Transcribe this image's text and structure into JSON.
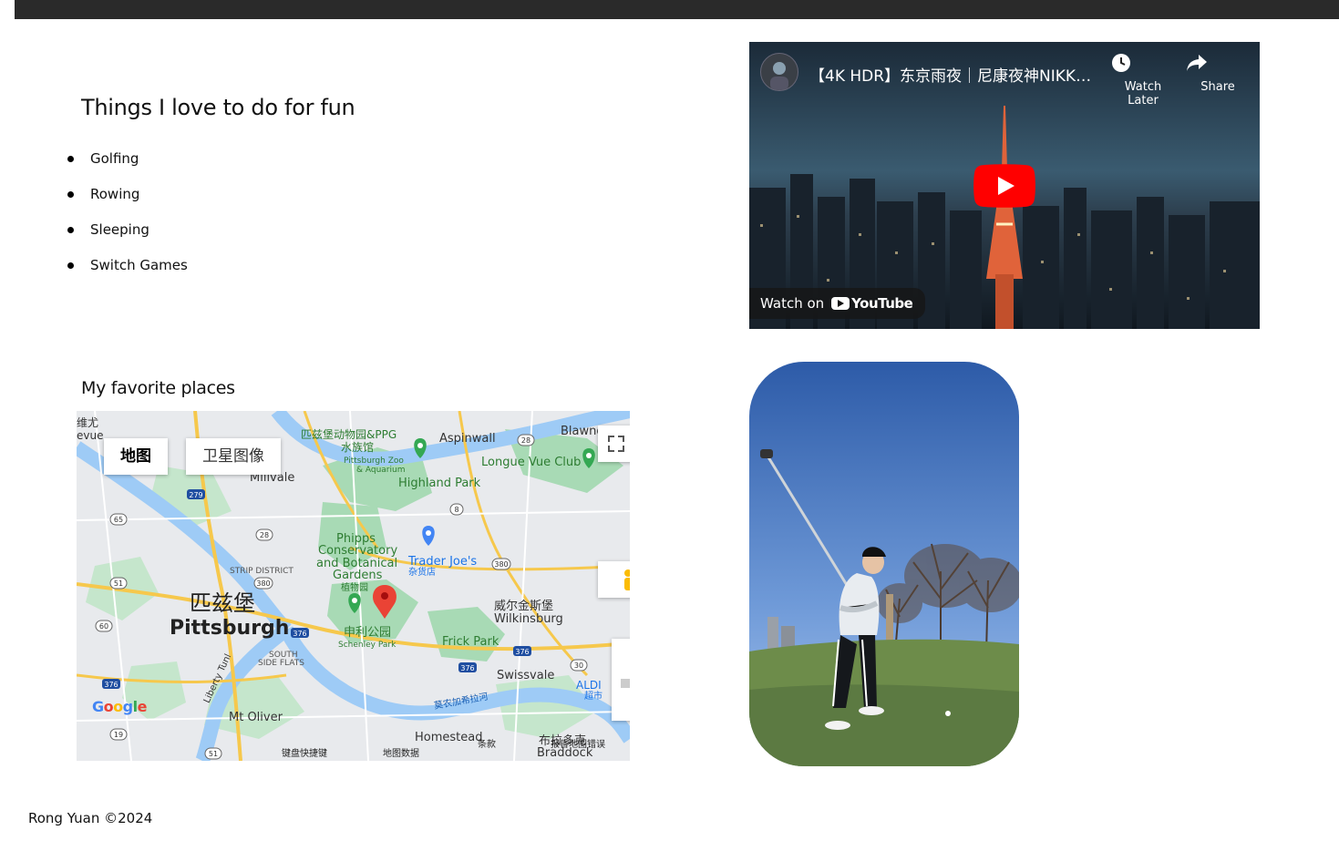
{
  "sections": {
    "fun_title": "Things I love to do for fun",
    "fun_items": [
      "Golfing",
      "Rowing",
      "Sleeping",
      "Switch Games"
    ],
    "places_title": "My favorite places"
  },
  "map": {
    "type_controls": [
      "地图",
      "卫星图像"
    ],
    "active_type": "地图",
    "labels": {
      "zoo": "匹兹堡动物园&PPG",
      "aquarium": "水族馆",
      "zoo_en1": "Pittsburgh Zoo",
      "zoo_en2": "& Aquarium",
      "aspinwall": "Aspinwall",
      "blawnox": "Blawno",
      "longue_vue": "Longue Vue Club",
      "highland_park": "Highland Park",
      "millvale": "Millvale",
      "phipps1": "Phipps",
      "phipps2": "Conservatory",
      "phipps3": "and Botanical",
      "phipps4": "Gardens",
      "phipps_cn": "植物园",
      "trader_joes": "Trader Joe's",
      "trader_joes_cn": "杂货店",
      "strip_district": "STRIP DISTRICT",
      "pittsburgh_cn": "匹兹堡",
      "pittsburgh": "Pittsburgh",
      "wilkinsburg_cn": "威尔金斯堡",
      "wilkinsburg": "Wilkinsburg",
      "schenley_cn": "申利公园",
      "schenley": "Schenley Park",
      "frick_park": "Frick Park",
      "south_side1": "SOUTH",
      "south_side2": "SIDE FLATS",
      "swissvale": "Swissvale",
      "aldi": "ALDI",
      "aldi_cn": "超市",
      "liberty_tunnel": "Liberty Tunl",
      "mt_oliver": "Mt Oliver",
      "homestead": "Homestead",
      "river": "莫农加希拉河",
      "braddock_cn": "布拉多克",
      "braddock": "Braddock",
      "weiyou": "维尤",
      "vue": "evue",
      "route_279": "279",
      "route_28a": "28",
      "route_28b": "28",
      "route_8": "8",
      "route_65": "65",
      "route_380a": "380",
      "route_380b": "380",
      "route_51a": "51",
      "route_51b": "51",
      "route_376a": "376",
      "route_376b": "376",
      "route_376c": "376",
      "route_376d": "376",
      "route_60": "60",
      "route_30": "30",
      "route_19": "19"
    },
    "footer": {
      "shortcuts": "键盘快捷键",
      "map_data": "地图数据",
      "terms": "条款",
      "report": "报告地图错误"
    },
    "google": "Google",
    "pin_color": "#ea4335"
  },
  "video": {
    "title": "【4K HDR】东京雨夜｜尼康夜神NIKK…",
    "watch_later": "Watch Later",
    "share": "Share",
    "watch_on": "Watch on",
    "youtube": "YouTube"
  },
  "footer": {
    "copyright": "Rong Yuan ©2024"
  }
}
